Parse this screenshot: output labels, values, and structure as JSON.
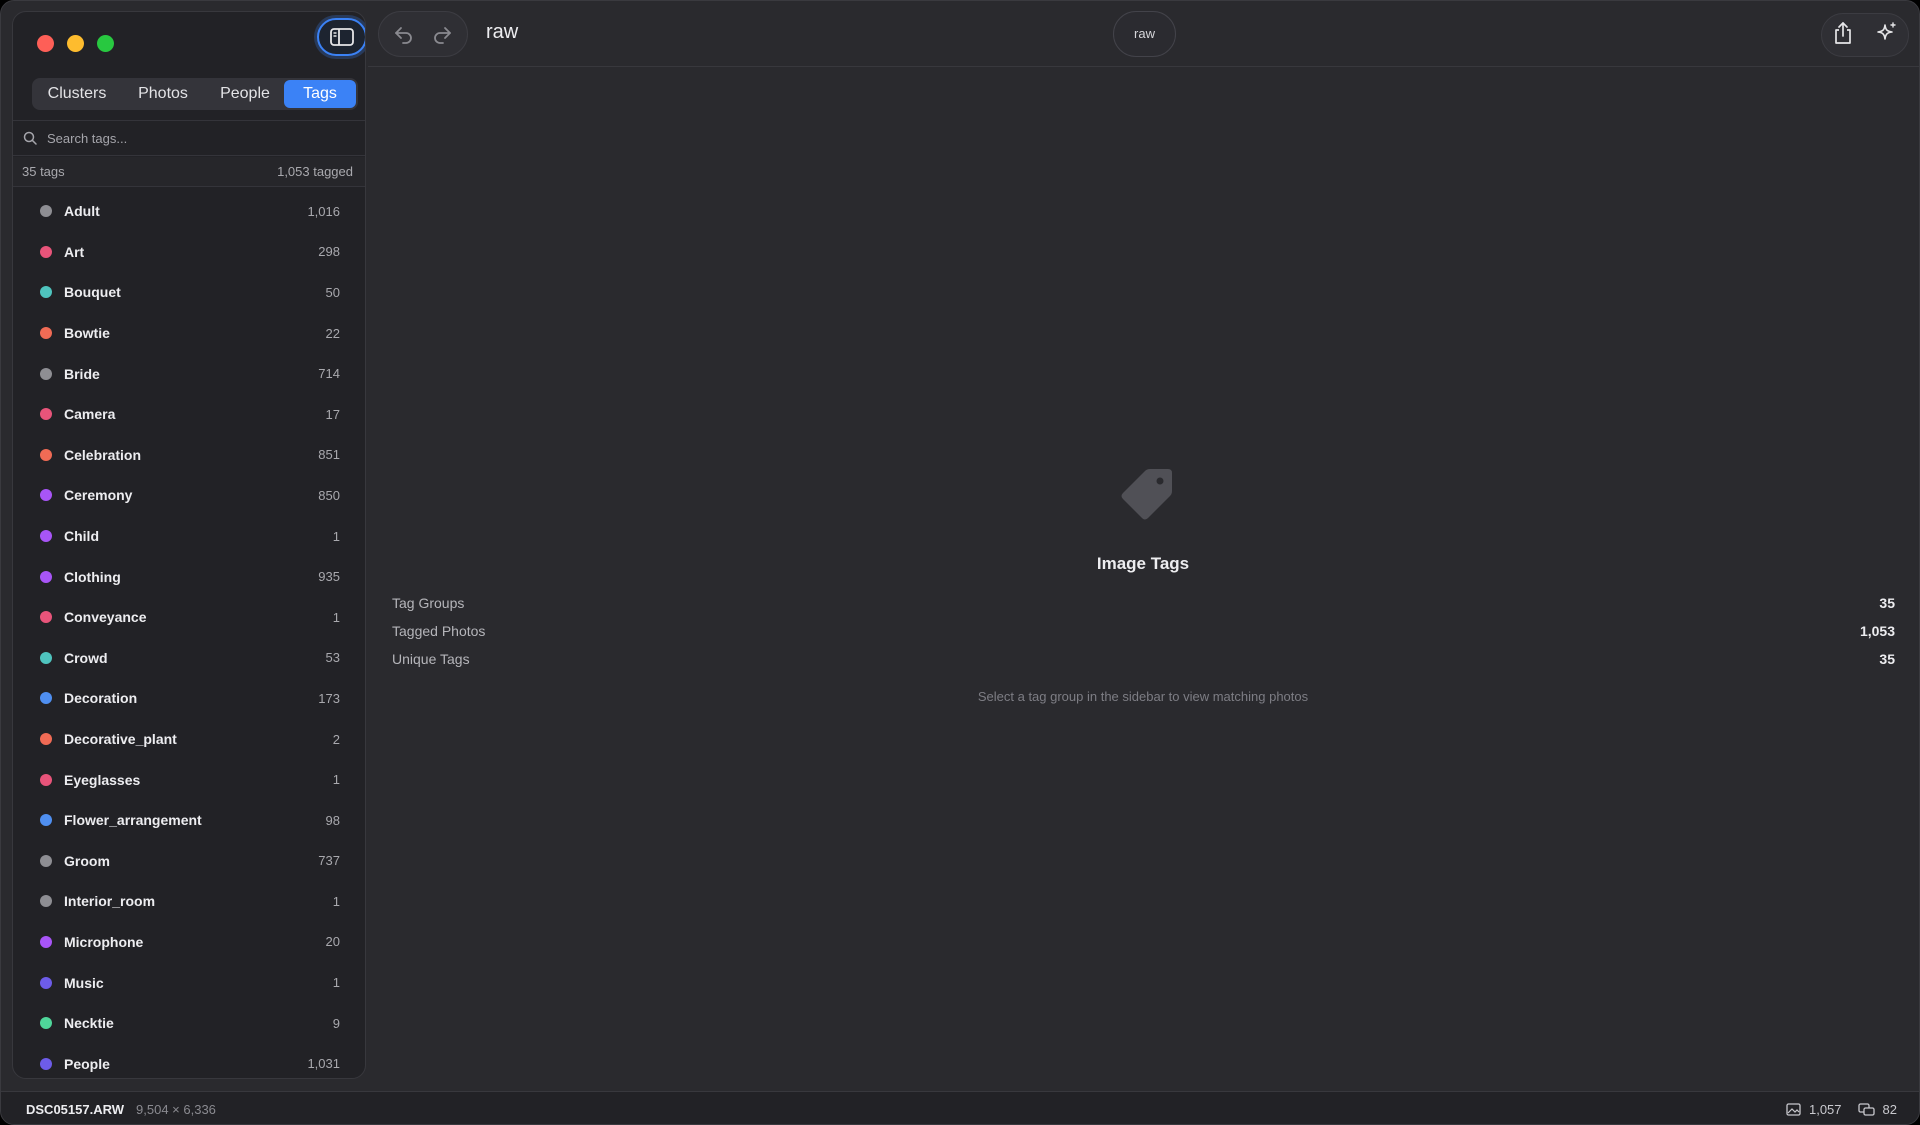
{
  "window": {
    "title": "raw",
    "center_pill": "raw"
  },
  "sidebar": {
    "tabs": [
      {
        "label": "Clusters",
        "active": false
      },
      {
        "label": "Photos",
        "active": false
      },
      {
        "label": "People",
        "active": false
      },
      {
        "label": "Tags",
        "active": true
      }
    ],
    "search": {
      "placeholder": "Search tags..."
    },
    "summary": {
      "tag_count": "35 tags",
      "tagged_count": "1,053 tagged"
    },
    "tags": [
      {
        "name": "Adult",
        "count": "1,016",
        "color": "#8e8e93"
      },
      {
        "name": "Art",
        "count": "298",
        "color": "#e8547a"
      },
      {
        "name": "Bouquet",
        "count": "50",
        "color": "#4fc4be"
      },
      {
        "name": "Bowtie",
        "count": "22",
        "color": "#f06b55"
      },
      {
        "name": "Bride",
        "count": "714",
        "color": "#8e8e93"
      },
      {
        "name": "Camera",
        "count": "17",
        "color": "#e8547a"
      },
      {
        "name": "Celebration",
        "count": "851",
        "color": "#f06b55"
      },
      {
        "name": "Ceremony",
        "count": "850",
        "color": "#a855f7"
      },
      {
        "name": "Child",
        "count": "1",
        "color": "#a855f7"
      },
      {
        "name": "Clothing",
        "count": "935",
        "color": "#a855f7"
      },
      {
        "name": "Conveyance",
        "count": "1",
        "color": "#e8547a"
      },
      {
        "name": "Crowd",
        "count": "53",
        "color": "#4fc4be"
      },
      {
        "name": "Decoration",
        "count": "173",
        "color": "#4f8ff0"
      },
      {
        "name": "Decorative_plant",
        "count": "2",
        "color": "#f06b55"
      },
      {
        "name": "Eyeglasses",
        "count": "1",
        "color": "#e8547a"
      },
      {
        "name": "Flower_arrangement",
        "count": "98",
        "color": "#4f8ff0"
      },
      {
        "name": "Groom",
        "count": "737",
        "color": "#8e8e93"
      },
      {
        "name": "Interior_room",
        "count": "1",
        "color": "#8e8e93"
      },
      {
        "name": "Microphone",
        "count": "20",
        "color": "#a855f7"
      },
      {
        "name": "Music",
        "count": "1",
        "color": "#6d5ce8"
      },
      {
        "name": "Necktie",
        "count": "9",
        "color": "#4fd69a"
      },
      {
        "name": "People",
        "count": "1,031",
        "color": "#6d5ce8"
      }
    ]
  },
  "main": {
    "title": "Image Tags",
    "stats": [
      {
        "label": "Tag Groups",
        "value": "35"
      },
      {
        "label": "Tagged Photos",
        "value": "1,053"
      },
      {
        "label": "Unique Tags",
        "value": "35"
      }
    ],
    "hint": "Select a tag group in the sidebar to view matching photos"
  },
  "statusbar": {
    "filename": "DSC05157.ARW",
    "dimensions": "9,504 × 6,336",
    "photo_count": "1,057",
    "cluster_count": "82"
  },
  "colors": {
    "accent": "#3b82f6"
  },
  "icons": {
    "toolbar": [
      "sidebar-toggle-icon",
      "undo-icon",
      "redo-icon",
      "share-icon",
      "sparkle-icon"
    ],
    "search": "search-icon",
    "empty_state": "tag-icon",
    "statusbar": [
      "photo-icon",
      "stack-icon"
    ]
  }
}
